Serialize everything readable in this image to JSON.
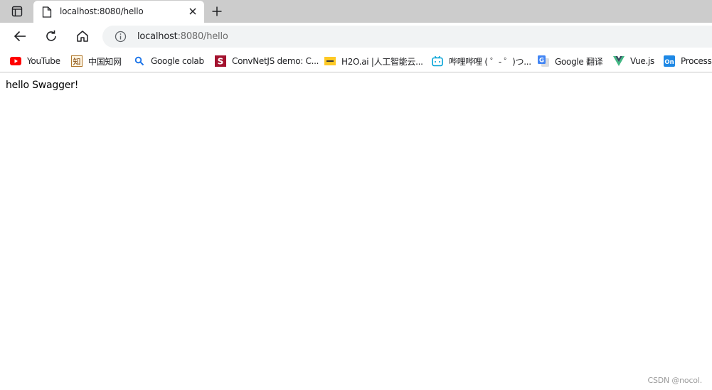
{
  "tab": {
    "title": "localhost:8080/hello",
    "favicon": "page-icon"
  },
  "address_bar": {
    "host": "localhost",
    "path": ":8080/hello",
    "icon": "info-icon"
  },
  "bookmarks": [
    {
      "label": "YouTube",
      "icon": "youtube-icon"
    },
    {
      "label": "中国知网",
      "icon": "cnki-icon"
    },
    {
      "label": "Google colab",
      "icon": "search-icon"
    },
    {
      "label": "ConvNetJS demo: C...",
      "icon": "convnetjs-icon"
    },
    {
      "label": "H2O.ai |人工智能云...",
      "icon": "h2o-icon"
    },
    {
      "label": "哔哩哔哩 ( ゜- ゜)つ...",
      "icon": "bilibili-icon"
    },
    {
      "label": "Google 翻译",
      "icon": "google-translate-icon"
    },
    {
      "label": "Vue.js",
      "icon": "vue-icon"
    },
    {
      "label": "ProcessOn",
      "icon": "processon-icon"
    }
  ],
  "page": {
    "text": "hello Swagger!"
  },
  "watermark": "CSDN @nocol.",
  "colors": {
    "tabstrip": "#cccccc",
    "omnibox": "#f1f3f4",
    "youtube": "#ff0000",
    "bilibili": "#00a1d6",
    "vue": "#41b883",
    "processon": "#1e88e5",
    "h2o": "#fec925",
    "convnetjs": "#a3122e"
  }
}
